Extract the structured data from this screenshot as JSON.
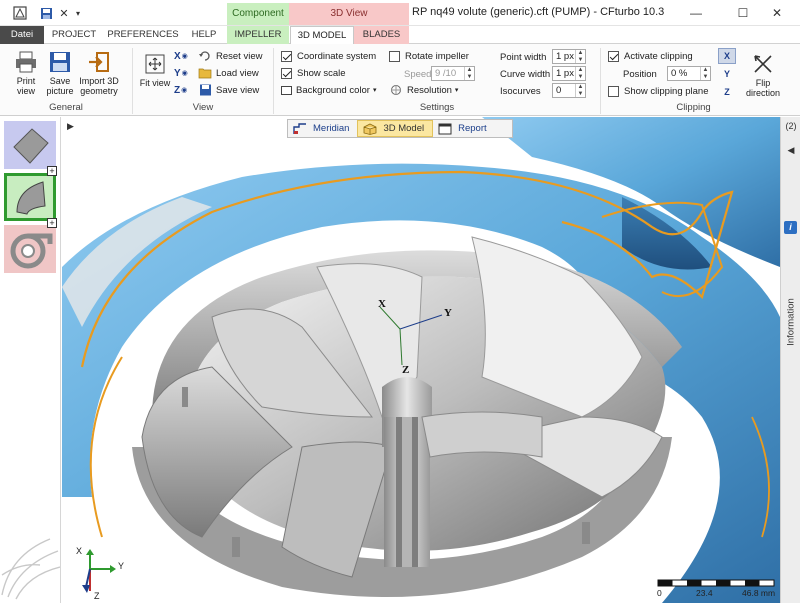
{
  "window": {
    "title": "RP nq49 volute (generic).cft (PUMP) - CFturbo 10.3",
    "context_component": "Component",
    "context_3dview": "3D View",
    "minimize_glyph": "—",
    "maximize_glyph": "☐",
    "close_glyph": "✕",
    "quick_access_icons": [
      "app-icon",
      "save-icon",
      "close-file-icon",
      "customize-dropdown-icon"
    ]
  },
  "tabs": [
    {
      "label": "Datei"
    },
    {
      "label": "PROJECT"
    },
    {
      "label": "PREFERENCES"
    },
    {
      "label": "HELP"
    },
    {
      "label": "IMPELLER"
    },
    {
      "label": "3D MODEL"
    },
    {
      "label": "BLADES"
    }
  ],
  "ribbon": {
    "general": {
      "label": "General",
      "print_view": "Print view",
      "save_picture": "Save picture",
      "import_3d": "Import 3D geometry"
    },
    "view": {
      "label": "View",
      "fit_view": "Fit view",
      "axis_x": "X",
      "axis_y": "Y",
      "axis_z": "Z",
      "reset_view": "Reset view",
      "load_view": "Load view",
      "save_view": "Save view"
    },
    "settings": {
      "label": "Settings",
      "coordinate_system": "Coordinate system",
      "coordinate_system_checked": true,
      "show_scale": "Show scale",
      "show_scale_checked": true,
      "background_color": "Background color",
      "rotate_impeller": "Rotate impeller",
      "rotate_impeller_checked": false,
      "speed_label": "Speed",
      "speed_value": "9 /10",
      "resolution": "Resolution",
      "point_width_label": "Point width",
      "point_width_value": "1 px",
      "curve_width_label": "Curve width",
      "curve_width_value": "1 px",
      "isocurves_label": "Isocurves",
      "isocurves_value": "0"
    },
    "clipping": {
      "label": "Clipping",
      "activate_clipping": "Activate clipping",
      "activate_clipping_checked": true,
      "position_label": "Position",
      "position_value": "0 %",
      "show_clipping_plane": "Show clipping plane",
      "show_clipping_plane_checked": false,
      "flip_direction": "Flip direction",
      "axis_x": "X",
      "axis_y": "Y",
      "axis_z": "Z"
    }
  },
  "view_tabs": [
    {
      "label": "Meridian",
      "icon": "meridian-icon"
    },
    {
      "label": "3D Model",
      "icon": "cube-icon",
      "active": true
    },
    {
      "label": "Report",
      "icon": "report-icon"
    }
  ],
  "model_axes": {
    "x": "X",
    "y": "Y",
    "z": "Z"
  },
  "corner_axes": {
    "x": "X",
    "y": "Y",
    "z": "Z"
  },
  "right_panel": {
    "count": "(2)",
    "label": "Information",
    "info_glyph": "i",
    "collapse_glyph": "◀"
  },
  "left_panel": {
    "expand_glyph": "▶",
    "plus_glyph": "+"
  },
  "scale": {
    "tick_0": "0",
    "tick_mid": "23.4",
    "tick_end": "46.8 mm"
  },
  "colors": {
    "volute": "#5aa7d9",
    "volute_edge": "#e89b20",
    "component_tab": "#c9efbf",
    "view_tab": "#f8c8c8",
    "active_view_tab": "#fbe7a1"
  }
}
